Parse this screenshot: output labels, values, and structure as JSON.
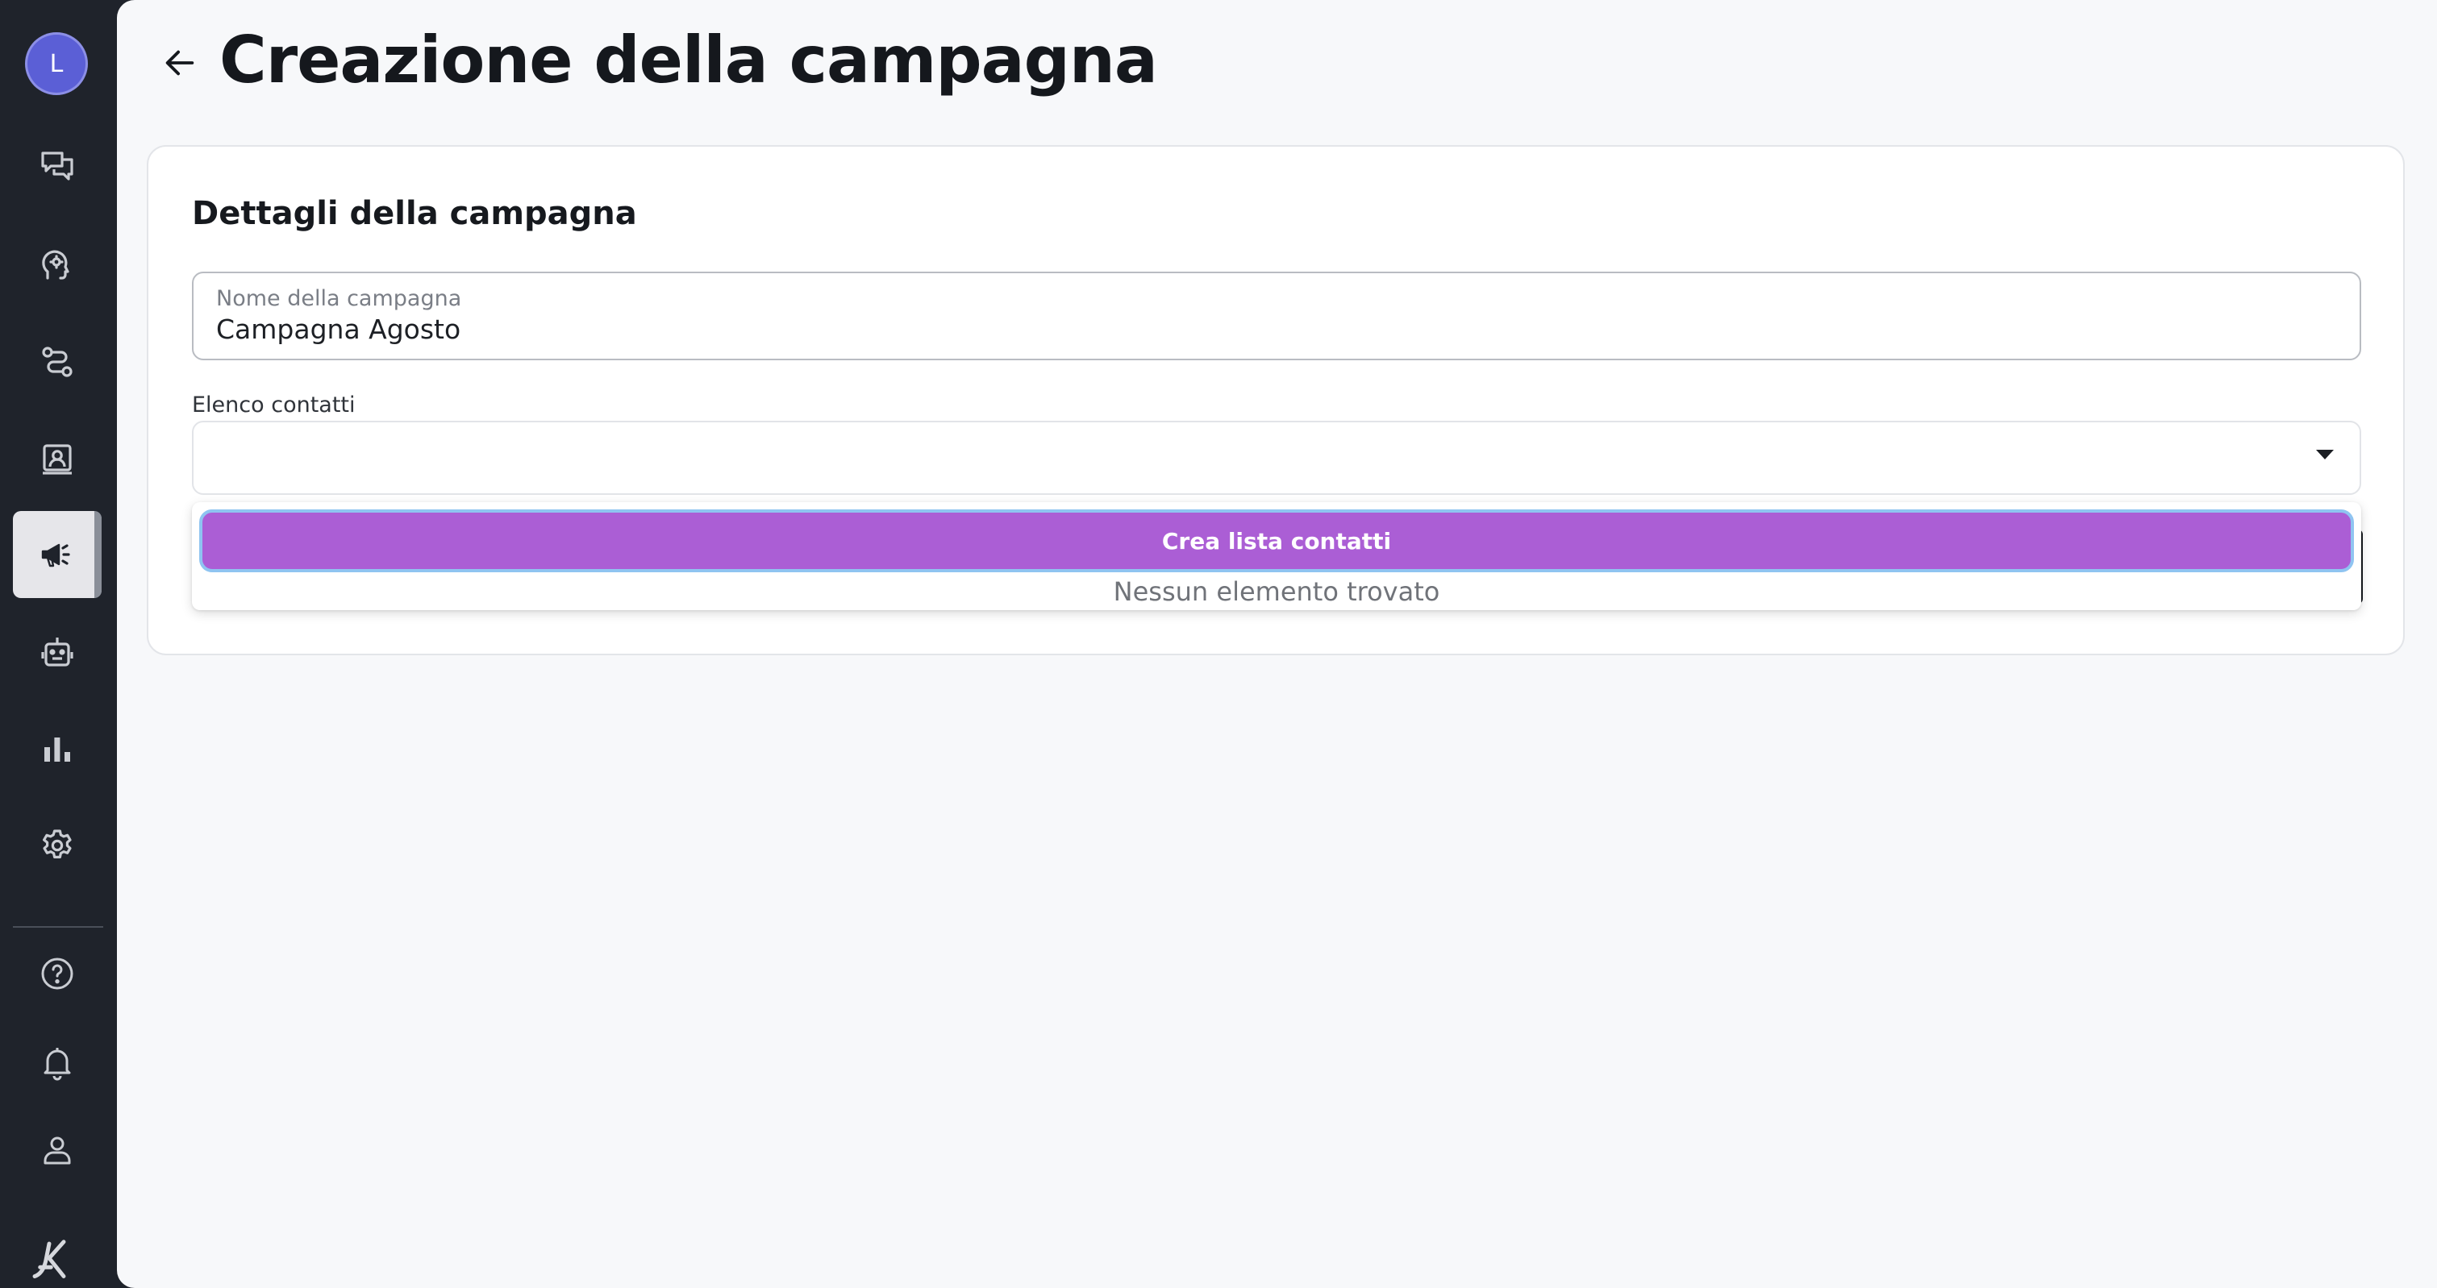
{
  "user": {
    "avatar_initial": "L"
  },
  "sidebar": {
    "items": [
      {
        "icon": "chat-bubbles-icon"
      },
      {
        "icon": "head-gear-icon"
      },
      {
        "icon": "workflow-icon"
      },
      {
        "icon": "contacts-card-icon"
      },
      {
        "icon": "megaphone-icon",
        "active": true
      },
      {
        "icon": "robot-icon"
      },
      {
        "icon": "bar-chart-icon"
      },
      {
        "icon": "gear-icon"
      }
    ],
    "bottom_items": [
      {
        "icon": "help-icon"
      },
      {
        "icon": "bell-icon"
      },
      {
        "icon": "user-icon"
      }
    ]
  },
  "header": {
    "title": "Creazione della campagna"
  },
  "card": {
    "title": "Dettagli della campagna",
    "campaign_name": {
      "label": "Nome della campagna",
      "value": "Campagna Agosto"
    },
    "contact_list": {
      "label": "Elenco contatti",
      "value": "",
      "dropdown": {
        "create_button_label": "Crea lista contatti",
        "empty_message": "Nessun elemento trovato"
      }
    }
  },
  "colors": {
    "sidebar_bg": "#1f232b",
    "main_bg": "#f7f8fa",
    "avatar": "#5b5fd6",
    "accent_purple": "#ab5ed5",
    "focus_ring": "#8fc4f1"
  }
}
